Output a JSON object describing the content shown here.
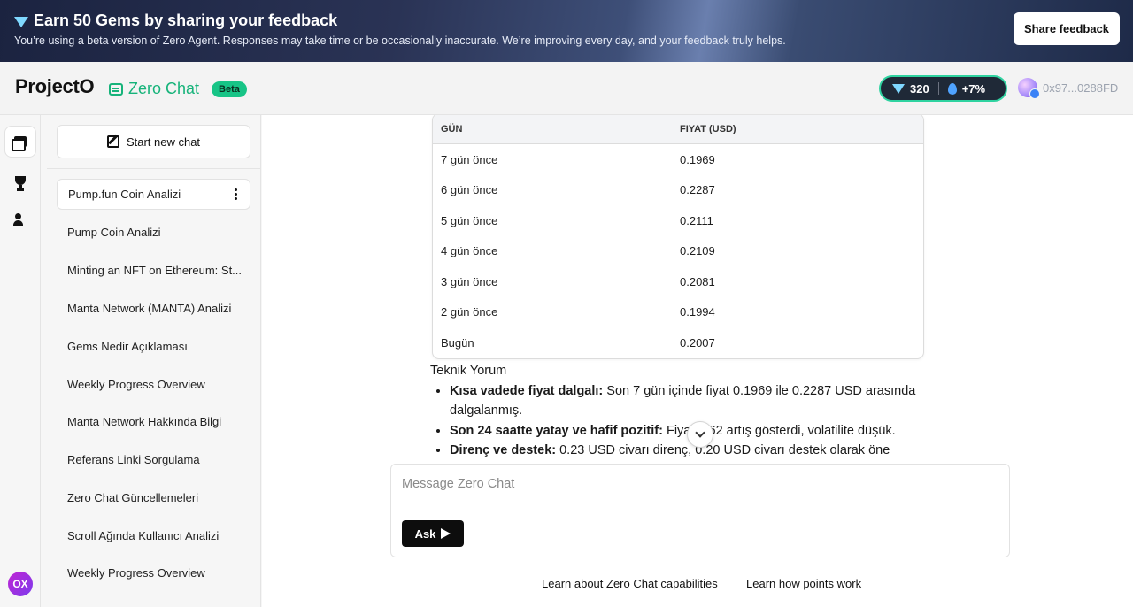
{
  "banner": {
    "title": "Earn 50 Gems by sharing your feedback",
    "subtitle": "You’re using a beta version of Zero Agent. Responses may take time or be occasionally inaccurate. We’re improving every day, and your feedback truly helps.",
    "share_label": "Share feedback",
    "icon": "gem-icon"
  },
  "header": {
    "logo": "ProjectO",
    "product": "Zero Chat",
    "beta": "Beta",
    "gems": "320",
    "streak": "+7%",
    "wallet": "0x97...0288FD"
  },
  "rail": {
    "badge": "OX"
  },
  "sidebar": {
    "new_chat_label": "Start new chat",
    "items": [
      {
        "label": "Pump.fun Coin Analizi"
      },
      {
        "label": "Pump Coin Analizi"
      },
      {
        "label": "Minting an NFT on Ethereum: St..."
      },
      {
        "label": "Manta Network (MANTA) Analizi"
      },
      {
        "label": "Gems Nedir Açıklaması"
      },
      {
        "label": "Weekly Progress Overview"
      },
      {
        "label": "Manta Network Hakkında Bilgi"
      },
      {
        "label": "Referans Linki Sorgulama"
      },
      {
        "label": "Zero Chat Güncellemeleri"
      },
      {
        "label": "Scroll Ağında Kullanıcı Analizi"
      },
      {
        "label": "Weekly Progress Overview"
      }
    ]
  },
  "table": {
    "headers": [
      "GÜN",
      "FIYAT (USD)"
    ],
    "rows": [
      [
        "7 gün önce",
        "0.1969"
      ],
      [
        "6 gün önce",
        "0.2287"
      ],
      [
        "5 gün önce",
        "0.2111"
      ],
      [
        "4 gün önce",
        "0.2109"
      ],
      [
        "3 gün önce",
        "0.2081"
      ],
      [
        "2 gün önce",
        "0.1994"
      ],
      [
        "Bugün",
        "0.2007"
      ]
    ]
  },
  "commentary": {
    "heading": "Teknik Yorum",
    "bullets": [
      {
        "bold": "Kısa vadede fiyat dalgalı:",
        "text": " Son 7 gün içinde fiyat 0.1969 ile 0.2287 USD arasında dalgalanmış."
      },
      {
        "bold": "Son 24 saatte yatay ve hafif pozitif:",
        "text": " Fiyat 0.62 artış gösterdi, volatilite düşük."
      },
      {
        "bold": "Direnç ve destek:",
        "text": " 0.23 USD civarı direnç, 0.20 USD civarı destek olarak öne"
      }
    ]
  },
  "composer": {
    "placeholder": "Message Zero Chat",
    "ask_label": "Ask"
  },
  "footer": {
    "capabilities": "Learn about Zero Chat capabilities",
    "points": "Learn how points work"
  }
}
